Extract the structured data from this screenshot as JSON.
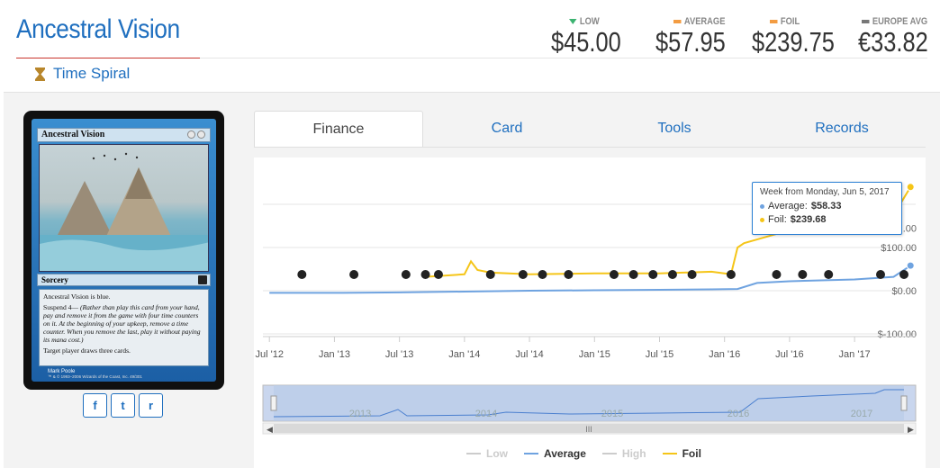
{
  "header": {
    "title": "Ancestral Vision",
    "set_name": "Time Spiral"
  },
  "prices": [
    {
      "label": "LOW",
      "value": "$45.00",
      "marker": "triangle-down-icon",
      "color": "#3cb371"
    },
    {
      "label": "AVERAGE",
      "value": "$57.95",
      "marker": "dash-icon",
      "color": "#f39c42"
    },
    {
      "label": "FOIL",
      "value": "$239.75",
      "marker": "dash-icon",
      "color": "#f39c42"
    },
    {
      "label": "EUROPE AVG",
      "value": "€33.82",
      "marker": "dash-icon",
      "color": "#777777"
    }
  ],
  "card": {
    "name": "Ancestral Vision",
    "type": "Sorcery",
    "rules_1": "Ancestral Vision is blue.",
    "rules_2": "Suspend 4—",
    "rules_2_reminder": "(Rather than play this card from your hand, pay and remove it from the game with four time counters on it. At the beginning of your upkeep, remove a time counter. When you remove the last, play it without paying its mana cost.)",
    "rules_3": "Target player draws three cards.",
    "artist": "Mark Poole",
    "copyright": "™ & © 1993–2006 Wizards of the Coast, Inc. 49/301"
  },
  "share": {
    "facebook": "f",
    "twitter": "t",
    "reddit": "r"
  },
  "tabs": [
    "Finance",
    "Card",
    "Tools",
    "Records"
  ],
  "tooltip": {
    "heading": "Week from Monday, Jun 5, 2017",
    "average_label": "Average:",
    "average_value": "$58.33",
    "foil_label": "Foil:",
    "foil_value": "$239.68"
  },
  "colors": {
    "average": "#6fa3e0",
    "foil": "#f5c518",
    "low": "#cccccc",
    "high": "#cccccc"
  },
  "chart_data": {
    "type": "line",
    "x_ticks": [
      "Jul '12",
      "Jan '13",
      "Jul '13",
      "Jan '14",
      "Jul '14",
      "Jan '15",
      "Jul '15",
      "Jan '16",
      "Jul '16",
      "Jan '17"
    ],
    "y_ticks": [
      "$100.00",
      "$0.00",
      "$-100.00"
    ],
    "y_tick_partial": ".00",
    "ylim": [
      -100,
      200
    ],
    "navigator_labels": [
      "2013",
      "2014",
      "2015",
      "2016",
      "2017"
    ],
    "legend": [
      "Low",
      "Average",
      "High",
      "Foil"
    ],
    "series": [
      {
        "name": "Average",
        "x": [
          2012.5,
          2013.0,
          2013.5,
          2014.0,
          2014.5,
          2015.0,
          2015.5,
          2015.9,
          2016.1,
          2016.25,
          2016.5,
          2017.0,
          2017.3,
          2017.43
        ],
        "y": [
          -5,
          -5,
          -4,
          -2,
          0,
          1,
          2,
          3,
          4,
          18,
          22,
          26,
          32,
          58
        ]
      },
      {
        "name": "Foil",
        "x": [
          2013.7,
          2013.9,
          2014.0,
          2014.05,
          2014.1,
          2014.2,
          2014.5,
          2015.0,
          2015.5,
          2015.9,
          2016.05,
          2016.1,
          2016.15,
          2016.5,
          2017.0,
          2017.3,
          2017.43
        ],
        "y": [
          32,
          36,
          38,
          68,
          48,
          42,
          38,
          40,
          40,
          44,
          38,
          100,
          110,
          140,
          165,
          175,
          240
        ]
      }
    ]
  }
}
